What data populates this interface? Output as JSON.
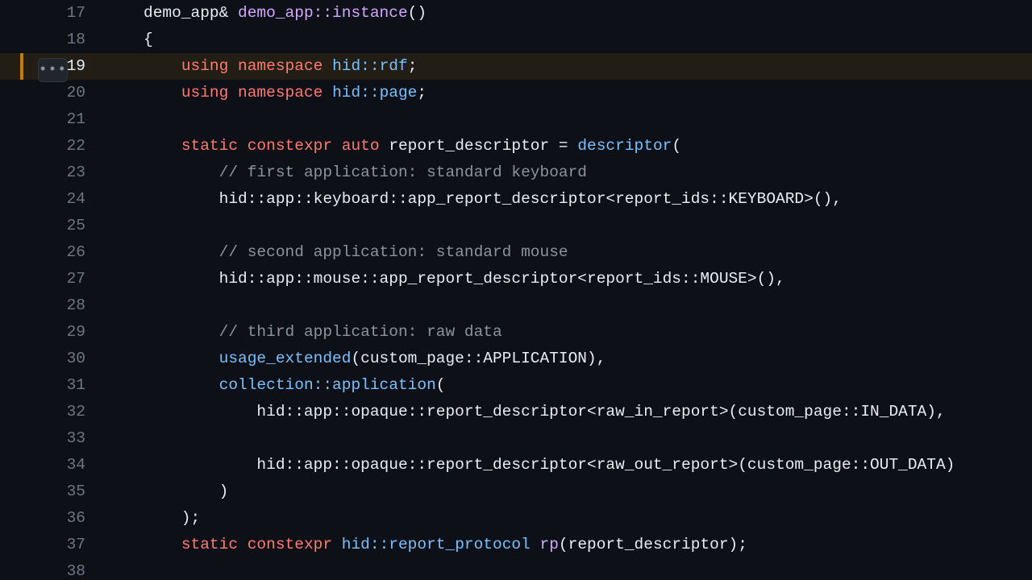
{
  "more_button_label": "•••",
  "lines": [
    {
      "num": "17",
      "highlighted": false,
      "tokens": [
        {
          "cls": "tk-pl",
          "text": "demo_app& "
        },
        {
          "cls": "tk-fn",
          "text": "demo_app::instance"
        },
        {
          "cls": "tk-pl",
          "text": "()"
        }
      ]
    },
    {
      "num": "18",
      "highlighted": false,
      "tokens": [
        {
          "cls": "tk-pl",
          "text": "{"
        }
      ]
    },
    {
      "num": "19",
      "highlighted": true,
      "tokens": [
        {
          "cls": "tk-pl",
          "text": "    "
        },
        {
          "cls": "tk-kw",
          "text": "using"
        },
        {
          "cls": "tk-pl",
          "text": " "
        },
        {
          "cls": "tk-kw",
          "text": "namespace"
        },
        {
          "cls": "tk-pl",
          "text": " "
        },
        {
          "cls": "tk-tp",
          "text": "hid::rdf"
        },
        {
          "cls": "tk-pl",
          "text": ";"
        }
      ]
    },
    {
      "num": "20",
      "highlighted": false,
      "tokens": [
        {
          "cls": "tk-pl",
          "text": "    "
        },
        {
          "cls": "tk-kw",
          "text": "using"
        },
        {
          "cls": "tk-pl",
          "text": " "
        },
        {
          "cls": "tk-kw",
          "text": "namespace"
        },
        {
          "cls": "tk-pl",
          "text": " "
        },
        {
          "cls": "tk-tp",
          "text": "hid::page"
        },
        {
          "cls": "tk-pl",
          "text": ";"
        }
      ]
    },
    {
      "num": "21",
      "highlighted": false,
      "tokens": [
        {
          "cls": "tk-pl",
          "text": ""
        }
      ]
    },
    {
      "num": "22",
      "highlighted": false,
      "tokens": [
        {
          "cls": "tk-pl",
          "text": "    "
        },
        {
          "cls": "tk-kw",
          "text": "static"
        },
        {
          "cls": "tk-pl",
          "text": " "
        },
        {
          "cls": "tk-kw",
          "text": "constexpr"
        },
        {
          "cls": "tk-pl",
          "text": " "
        },
        {
          "cls": "tk-kw",
          "text": "auto"
        },
        {
          "cls": "tk-pl",
          "text": " report_descriptor = "
        },
        {
          "cls": "tk-tp",
          "text": "descriptor"
        },
        {
          "cls": "tk-pl",
          "text": "("
        }
      ]
    },
    {
      "num": "23",
      "highlighted": false,
      "tokens": [
        {
          "cls": "tk-pl",
          "text": "        "
        },
        {
          "cls": "tk-cm",
          "text": "// first application: standard keyboard"
        }
      ]
    },
    {
      "num": "24",
      "highlighted": false,
      "tokens": [
        {
          "cls": "tk-pl",
          "text": "        hid::app::keyboard::app_report_descriptor<report_ids::KEYBOARD>(),"
        }
      ]
    },
    {
      "num": "25",
      "highlighted": false,
      "tokens": [
        {
          "cls": "tk-pl",
          "text": ""
        }
      ]
    },
    {
      "num": "26",
      "highlighted": false,
      "tokens": [
        {
          "cls": "tk-pl",
          "text": "        "
        },
        {
          "cls": "tk-cm",
          "text": "// second application: standard mouse"
        }
      ]
    },
    {
      "num": "27",
      "highlighted": false,
      "tokens": [
        {
          "cls": "tk-pl",
          "text": "        hid::app::mouse::app_report_descriptor<report_ids::MOUSE>(),"
        }
      ]
    },
    {
      "num": "28",
      "highlighted": false,
      "tokens": [
        {
          "cls": "tk-pl",
          "text": ""
        }
      ]
    },
    {
      "num": "29",
      "highlighted": false,
      "tokens": [
        {
          "cls": "tk-pl",
          "text": "        "
        },
        {
          "cls": "tk-cm",
          "text": "// third application: raw data"
        }
      ]
    },
    {
      "num": "30",
      "highlighted": false,
      "tokens": [
        {
          "cls": "tk-pl",
          "text": "        "
        },
        {
          "cls": "tk-tp",
          "text": "usage_extended"
        },
        {
          "cls": "tk-pl",
          "text": "(custom_page::APPLICATION),"
        }
      ]
    },
    {
      "num": "31",
      "highlighted": false,
      "tokens": [
        {
          "cls": "tk-pl",
          "text": "        "
        },
        {
          "cls": "tk-tp",
          "text": "collection::application"
        },
        {
          "cls": "tk-pl",
          "text": "("
        }
      ]
    },
    {
      "num": "32",
      "highlighted": false,
      "tokens": [
        {
          "cls": "tk-pl",
          "text": "            hid::app::opaque::report_descriptor<raw_in_report>(custom_page::IN_DATA),"
        }
      ]
    },
    {
      "num": "33",
      "highlighted": false,
      "tokens": [
        {
          "cls": "tk-pl",
          "text": ""
        }
      ]
    },
    {
      "num": "34",
      "highlighted": false,
      "tokens": [
        {
          "cls": "tk-pl",
          "text": "            hid::app::opaque::report_descriptor<raw_out_report>(custom_page::OUT_DATA)"
        }
      ]
    },
    {
      "num": "35",
      "highlighted": false,
      "tokens": [
        {
          "cls": "tk-pl",
          "text": "        )"
        }
      ]
    },
    {
      "num": "36",
      "highlighted": false,
      "tokens": [
        {
          "cls": "tk-pl",
          "text": "    );"
        }
      ]
    },
    {
      "num": "37",
      "highlighted": false,
      "tokens": [
        {
          "cls": "tk-pl",
          "text": "    "
        },
        {
          "cls": "tk-kw",
          "text": "static"
        },
        {
          "cls": "tk-pl",
          "text": " "
        },
        {
          "cls": "tk-kw",
          "text": "constexpr"
        },
        {
          "cls": "tk-pl",
          "text": " "
        },
        {
          "cls": "tk-tp",
          "text": "hid::report_protocol"
        },
        {
          "cls": "tk-pl",
          "text": " "
        },
        {
          "cls": "tk-fn",
          "text": "rp"
        },
        {
          "cls": "tk-pl",
          "text": "(report_descriptor);"
        }
      ]
    },
    {
      "num": "38",
      "highlighted": false,
      "tokens": [
        {
          "cls": "tk-pl",
          "text": ""
        }
      ]
    }
  ]
}
